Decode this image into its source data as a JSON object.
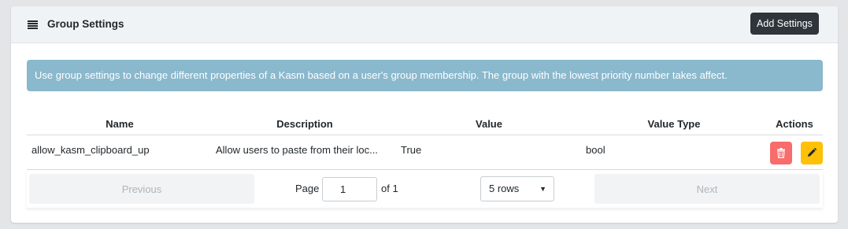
{
  "header": {
    "title": "Group Settings",
    "add_button_label": "Add Settings",
    "menu_icon": "hamburger-icon"
  },
  "alert": {
    "text": "Use group settings to change different properties of a Kasm based on a user's group membership. The group with the lowest priority number takes affect."
  },
  "table": {
    "columns": [
      "Name",
      "Description",
      "Value",
      "Value Type",
      "Actions"
    ],
    "rows": [
      {
        "name": "allow_kasm_clipboard_up",
        "description": "Allow users to paste from their loc...",
        "value": "True",
        "value_type": "bool",
        "actions": [
          "trash-icon",
          "pencil-icon"
        ]
      }
    ]
  },
  "pagination": {
    "previous_label": "Previous",
    "next_label": "Next",
    "page_label": "Page",
    "page_value": "1",
    "of_label": "of 1",
    "rows_selected": "5 rows"
  },
  "colors": {
    "header_bg": "#f0f3f5",
    "dark_button": "#2f353a",
    "alert_bg": "#8ab8cc",
    "delete": "#f86c6b",
    "edit": "#ffc107"
  }
}
